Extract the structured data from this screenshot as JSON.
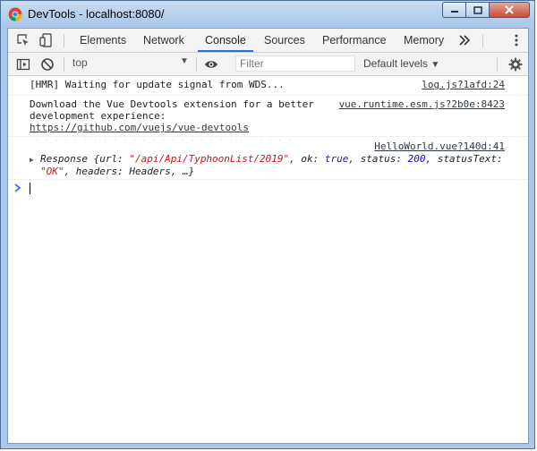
{
  "window": {
    "title": "DevTools - localhost:8080/"
  },
  "tabs": [
    "Elements",
    "Network",
    "Console",
    "Sources",
    "Performance",
    "Memory"
  ],
  "more_tabs_icon": "double-chevron-icon",
  "toolbar": {
    "context": "top",
    "filter_placeholder": "Filter",
    "levels": "Default levels"
  },
  "messages": [
    {
      "text": "[HMR] Waiting for update signal from WDS...",
      "source": "log.js?1afd:24"
    },
    {
      "text": "Download the Vue Devtools extension for a better development experience:",
      "link": "https://github.com/vuejs/vue-devtools",
      "source": "vue.runtime.esm.js?2b0e:8423"
    }
  ],
  "log_object": {
    "source": "HelloWorld.vue?140d:41",
    "prefix": "Response {url: ",
    "url": "\"/api/Api/TyphoonList/2019\"",
    "ok_label": ", ok: ",
    "ok_value": "true",
    "status_label": ", status: ",
    "status_value": "200",
    "status_text_label": ", statusText:",
    "status_text_value": "\"OK\"",
    "suffix": ", headers: Headers, …}"
  },
  "colors": {
    "accent": "#1a73e8",
    "string": "#c41a16",
    "keyword": "#1a1aa6",
    "number": "#1c00cf",
    "prompt": "#367cf1"
  }
}
